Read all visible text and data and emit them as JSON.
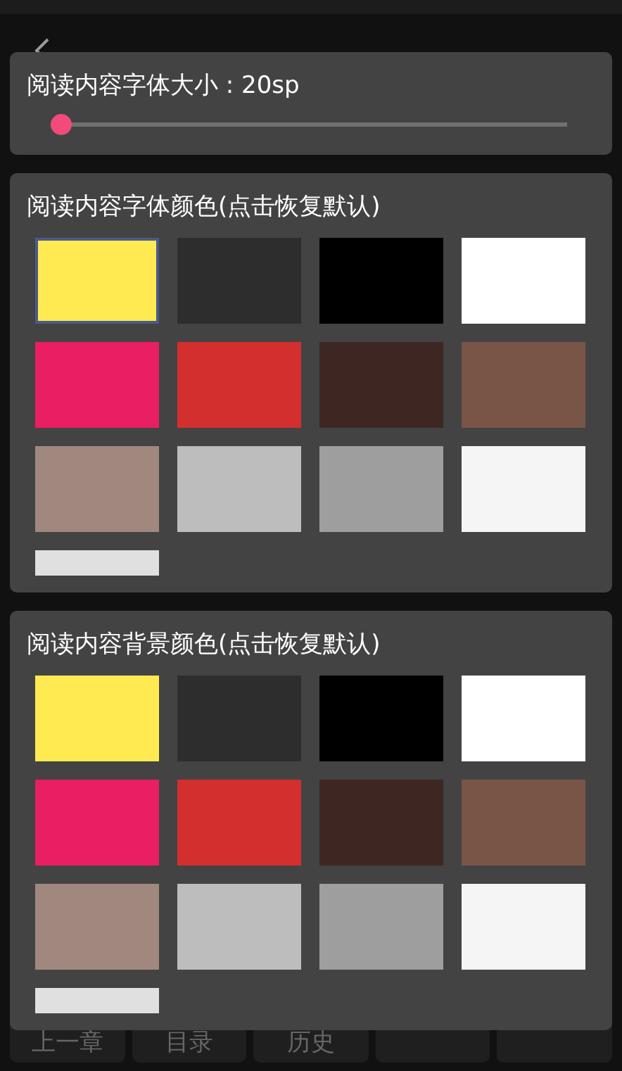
{
  "size_panel": {
    "label": "阅读内容字体大小 : 20sp",
    "level": 0
  },
  "font_color_panel": {
    "title": "阅读内容字体颜色(点击恢复默认)",
    "swatches": [
      {
        "color": "#ffeb51",
        "selected": true
      },
      {
        "color": "#2d2d2d",
        "selected": false
      },
      {
        "color": "#000000",
        "selected": false
      },
      {
        "color": "#ffffff",
        "selected": false
      },
      {
        "color": "#e91e63",
        "selected": false
      },
      {
        "color": "#d32f2f",
        "selected": false
      },
      {
        "color": "#3e2723",
        "selected": false
      },
      {
        "color": "#795548",
        "selected": false
      },
      {
        "color": "#a1887f",
        "selected": false
      },
      {
        "color": "#bdbdbd",
        "selected": false
      },
      {
        "color": "#9e9e9e",
        "selected": false
      },
      {
        "color": "#f5f5f5",
        "selected": false
      },
      {
        "color": "#e0e0e0",
        "selected": false
      }
    ]
  },
  "bg_color_panel": {
    "title": "阅读内容背景颜色(点击恢复默认)",
    "swatches": [
      {
        "color": "#ffeb51",
        "selected": false
      },
      {
        "color": "#2d2d2d",
        "selected": false
      },
      {
        "color": "#000000",
        "selected": false
      },
      {
        "color": "#ffffff",
        "selected": false
      },
      {
        "color": "#e91e63",
        "selected": false
      },
      {
        "color": "#d32f2f",
        "selected": false
      },
      {
        "color": "#3e2723",
        "selected": false
      },
      {
        "color": "#795548",
        "selected": false
      },
      {
        "color": "#a1887f",
        "selected": false
      },
      {
        "color": "#bdbdbd",
        "selected": false
      },
      {
        "color": "#9e9e9e",
        "selected": false
      },
      {
        "color": "#f5f5f5",
        "selected": false
      },
      {
        "color": "#e0e0e0",
        "selected": false
      }
    ]
  },
  "bottom_bar": [
    {
      "kind": "labeled",
      "label": "上一章"
    },
    {
      "kind": "labeled",
      "label": "目录"
    },
    {
      "kind": "labeled",
      "label": "历史"
    },
    {
      "kind": "blank"
    },
    {
      "kind": "blank"
    }
  ]
}
